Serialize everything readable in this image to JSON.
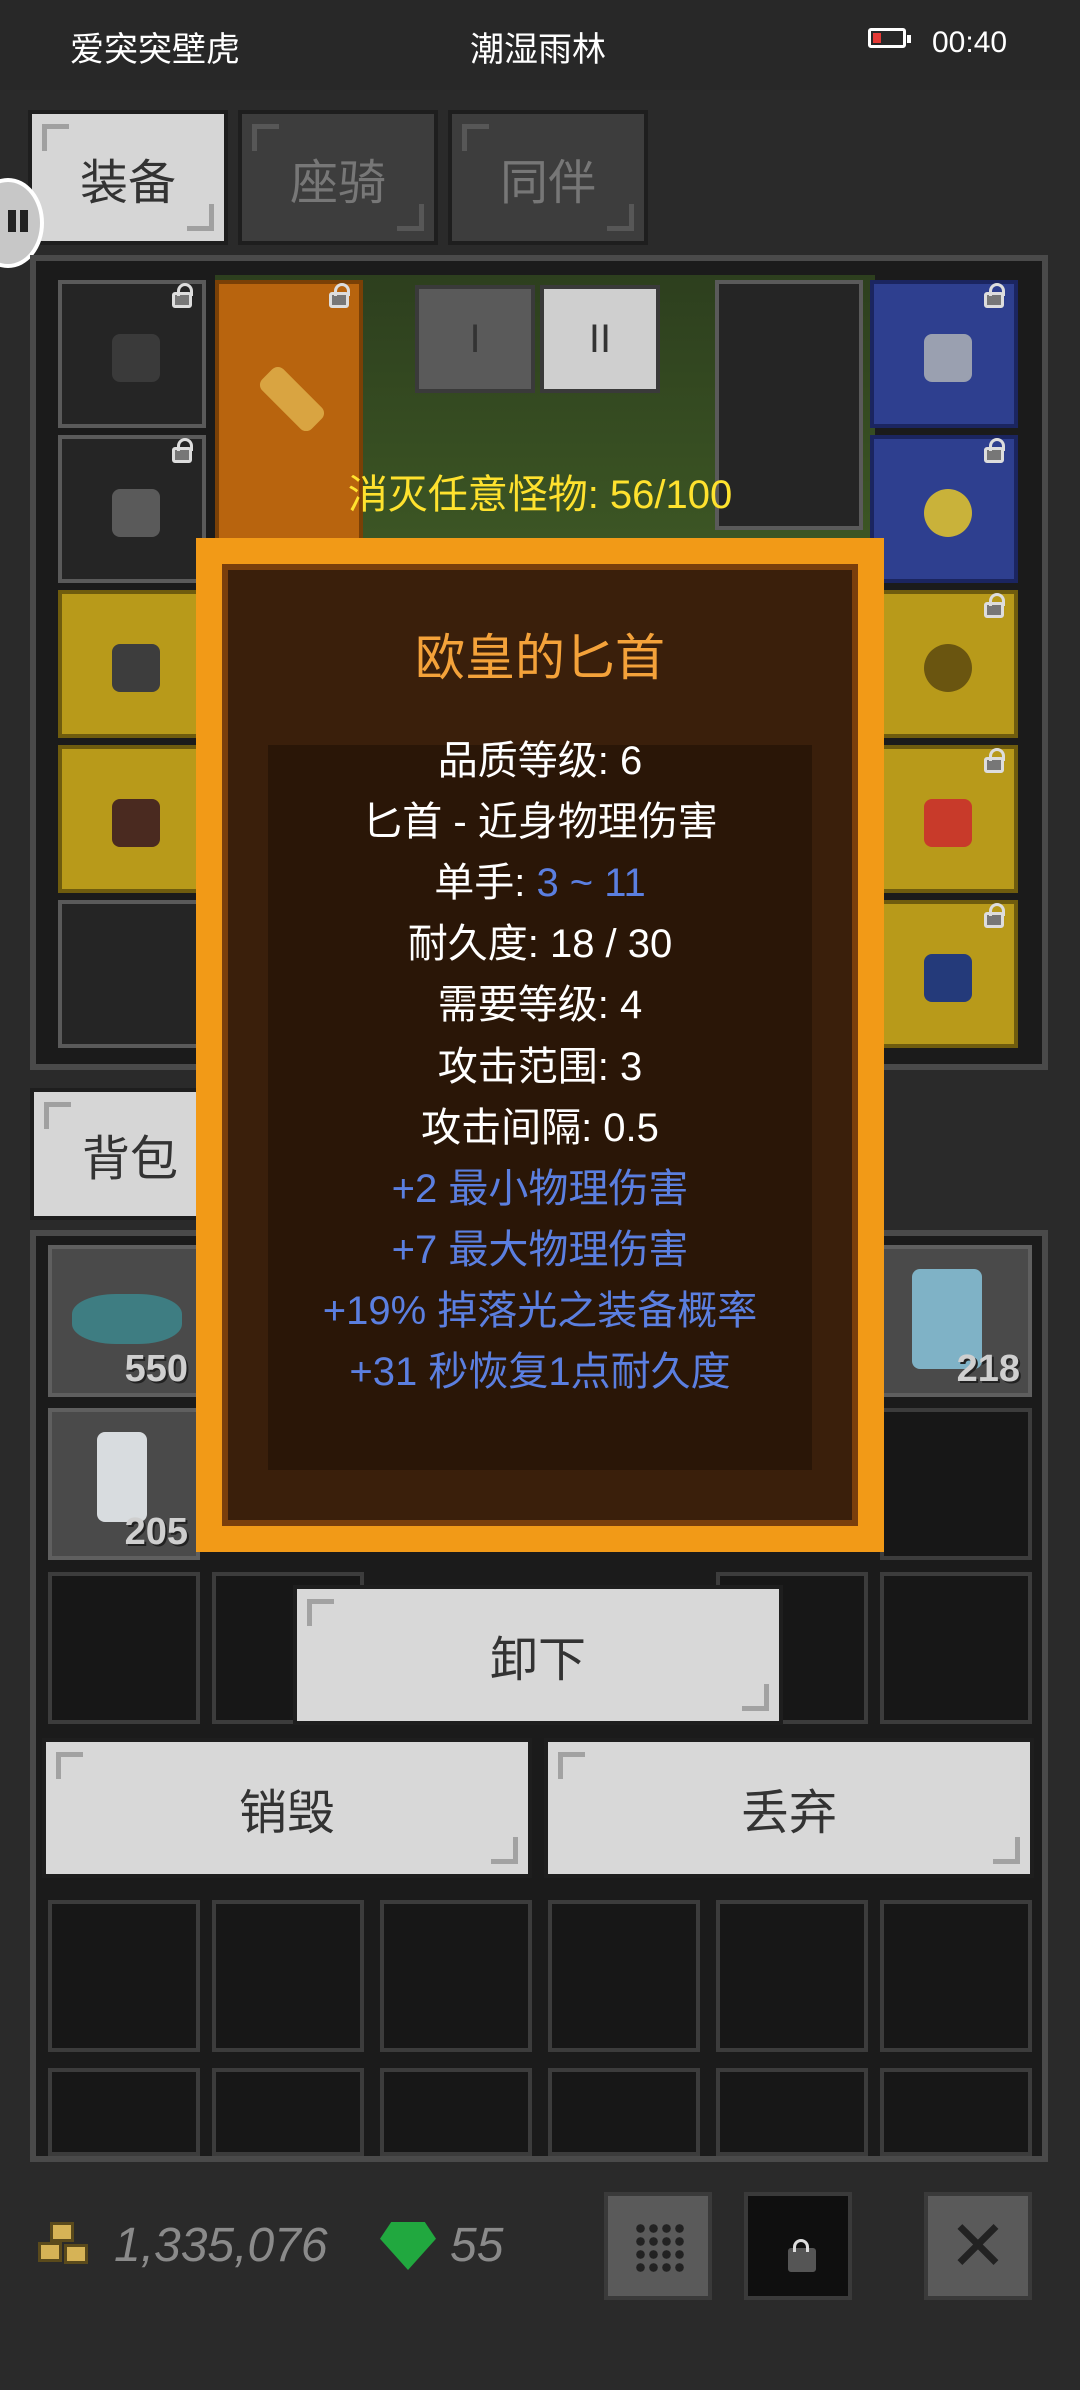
{
  "status_bar": {
    "app_title": "爱突突壁虎",
    "location": "潮湿雨林",
    "time": "00:40"
  },
  "tabs": [
    {
      "label": "装备",
      "active": true
    },
    {
      "label": "座骑",
      "active": false
    },
    {
      "label": "同伴",
      "active": false
    }
  ],
  "scene_buttons": [
    "I",
    "II"
  ],
  "quest": "消灭任意怪物: 56/100",
  "item_tooltip": {
    "name": "欧皇的匕首",
    "quality_label": "品质等级: 6",
    "type_label": "匕首 - 近身物理伤害",
    "hand_label": "单手: ",
    "hand_value": "3 ~ 11",
    "durability": "耐久度: 18 / 30",
    "required_level": "需要等级: 4",
    "attack_range": "攻击范围: 3",
    "attack_interval": "攻击间隔: 0.5",
    "bonuses": [
      "+2 最小物理伤害",
      "+7 最大物理伤害",
      "+19% 掉落光之装备概率",
      "+31 秒恢复1点耐久度"
    ]
  },
  "bag_tab": "背包",
  "bag_counts": [
    "550",
    "218",
    "205"
  ],
  "actions": {
    "unequip": "卸下",
    "destroy": "销毁",
    "discard": "丢弃"
  },
  "currency": {
    "gold": "1,335,076",
    "gems": "55"
  },
  "colors": {
    "tooltip_border": "#f29a17",
    "title_color": "#f4a23a",
    "bonus_color": "#5b7fe0",
    "quest_color": "#ffe22e"
  }
}
